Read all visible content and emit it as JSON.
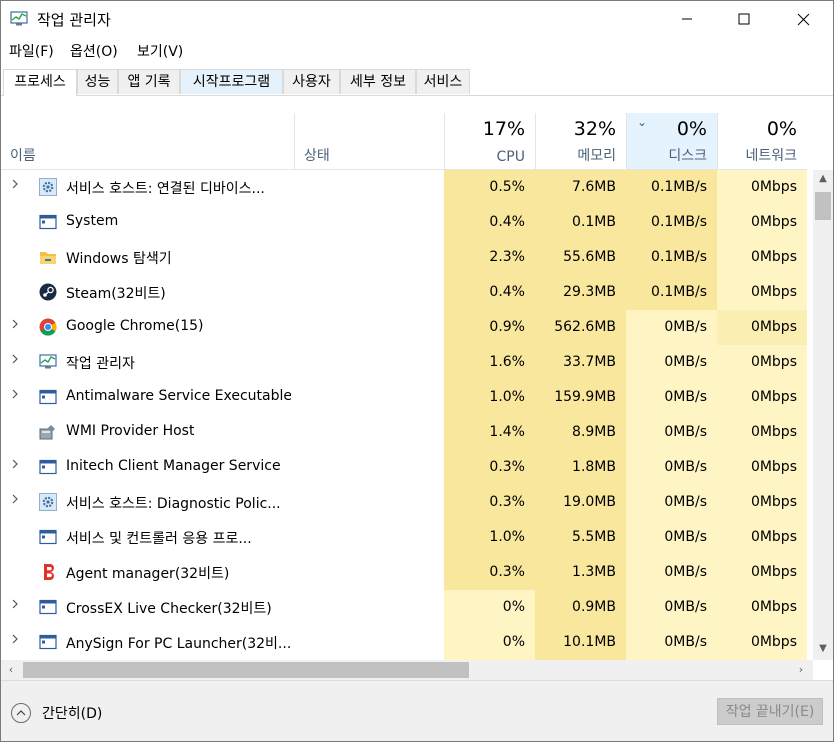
{
  "window": {
    "title": "작업 관리자"
  },
  "menubar": {
    "items": [
      "파일(F)",
      "옵션(O)",
      "보기(V)"
    ]
  },
  "tabs": [
    "프로세스",
    "성능",
    "앱 기록",
    "시작프로그램",
    "사용자",
    "세부 정보",
    "서비스"
  ],
  "header": {
    "name": "이름",
    "status": "상태",
    "cpu": {
      "percent": "17%",
      "label": "CPU"
    },
    "memory": {
      "percent": "32%",
      "label": "메모리"
    },
    "disk": {
      "percent": "0%",
      "label": "디스크"
    },
    "network": {
      "percent": "0%",
      "label": "네트워크"
    }
  },
  "processes": [
    {
      "name": "서비스 호스트: 연결된 디바이스...",
      "icon": "gear-icon",
      "expandable": true,
      "cpu": "0.5%",
      "memory": "7.6MB",
      "disk": "0.1MB/s",
      "network": "0Mbps"
    },
    {
      "name": "System",
      "icon": "window-app-icon",
      "expandable": false,
      "cpu": "0.4%",
      "memory": "0.1MB",
      "disk": "0.1MB/s",
      "network": "0Mbps"
    },
    {
      "name": "Windows 탐색기",
      "icon": "folder-icon",
      "expandable": false,
      "cpu": "2.3%",
      "memory": "55.6MB",
      "disk": "0.1MB/s",
      "network": "0Mbps"
    },
    {
      "name": "Steam(32비트)",
      "icon": "steam-icon",
      "expandable": false,
      "cpu": "0.4%",
      "memory": "29.3MB",
      "disk": "0.1MB/s",
      "network": "0Mbps"
    },
    {
      "name": "Google Chrome(15)",
      "icon": "chrome-icon",
      "expandable": true,
      "cpu": "0.9%",
      "memory": "562.6MB",
      "disk": "0MB/s",
      "network": "0Mbps"
    },
    {
      "name": "작업 관리자",
      "icon": "task-manager-icon",
      "expandable": true,
      "cpu": "1.6%",
      "memory": "33.7MB",
      "disk": "0MB/s",
      "network": "0Mbps"
    },
    {
      "name": "Antimalware Service Executable",
      "icon": "window-app-icon",
      "expandable": true,
      "cpu": "1.0%",
      "memory": "159.9MB",
      "disk": "0MB/s",
      "network": "0Mbps"
    },
    {
      "name": "WMI Provider Host",
      "icon": "wmi-icon",
      "expandable": false,
      "cpu": "1.4%",
      "memory": "8.9MB",
      "disk": "0MB/s",
      "network": "0Mbps"
    },
    {
      "name": "Initech Client Manager Service",
      "icon": "window-app-icon",
      "expandable": true,
      "cpu": "0.3%",
      "memory": "1.8MB",
      "disk": "0MB/s",
      "network": "0Mbps"
    },
    {
      "name": "서비스 호스트: Diagnostic Polic...",
      "icon": "gear-icon",
      "expandable": true,
      "cpu": "0.3%",
      "memory": "19.0MB",
      "disk": "0MB/s",
      "network": "0Mbps"
    },
    {
      "name": "서비스 및 컨트롤러 응용 프로...",
      "icon": "window-app-icon",
      "expandable": false,
      "cpu": "1.0%",
      "memory": "5.5MB",
      "disk": "0MB/s",
      "network": "0Mbps"
    },
    {
      "name": "Agent manager(32비트)",
      "icon": "agent-icon",
      "expandable": false,
      "cpu": "0.3%",
      "memory": "1.3MB",
      "disk": "0MB/s",
      "network": "0Mbps"
    },
    {
      "name": "CrossEX Live Checker(32비트)",
      "icon": "window-app-icon",
      "expandable": true,
      "cpu": "0%",
      "memory": "0.9MB",
      "disk": "0MB/s",
      "network": "0Mbps"
    },
    {
      "name": "AnySign For PC Launcher(32비...",
      "icon": "window-app-icon",
      "expandable": true,
      "cpu": "0%",
      "memory": "10.1MB",
      "disk": "0MB/s",
      "network": "0Mbps"
    }
  ],
  "footer": {
    "fewer_details": "간단히(D)",
    "end_task": "작업 끝내기(E)"
  },
  "colors": {
    "heat_high": "#f9e79d",
    "heat_mid": "#fbeeb3",
    "heat_low": "#fff4c4",
    "sorted_header": "#e5f3ff",
    "disabled_button": "#cccccc"
  }
}
